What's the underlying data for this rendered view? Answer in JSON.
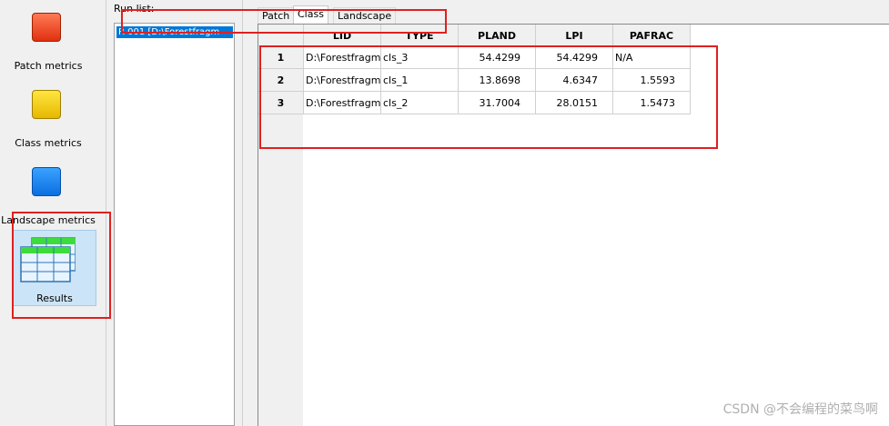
{
  "nav": {
    "items": [
      {
        "label": "Patch metrics",
        "icon": "red-square-icon"
      },
      {
        "label": "Class metrics",
        "icon": "yellow-square-icon"
      },
      {
        "label": "Landscape metrics",
        "icon": "blue-square-icon"
      },
      {
        "label": "Results",
        "icon": "table-grid-icon"
      }
    ]
  },
  "runlist": {
    "label": "Run list:",
    "items": [
      "R 001 [D:\\Forestfragm"
    ]
  },
  "tabs": [
    "Patch",
    "Class",
    "Landscape"
  ],
  "active_tab": "Class",
  "table": {
    "columns": [
      "LID",
      "TYPE",
      "PLAND",
      "LPI",
      "PAFRAC"
    ],
    "rows": [
      {
        "index": "1",
        "cells": [
          "D:\\Forestfragm",
          "cls_3",
          "54.4299",
          "54.4299",
          "N/A"
        ]
      },
      {
        "index": "2",
        "cells": [
          "D:\\Forestfragm",
          "cls_1",
          "13.8698",
          "4.6347",
          "1.5593"
        ]
      },
      {
        "index": "3",
        "cells": [
          "D:\\Forestfragm",
          "cls_2",
          "31.7004",
          "28.0151",
          "1.5473"
        ]
      }
    ]
  },
  "colors": {
    "annotation": "#e02020",
    "selection": "#0078d7",
    "results_bg": "#cce4f7"
  },
  "watermark": "CSDN @不会编程的菜鸟啊"
}
